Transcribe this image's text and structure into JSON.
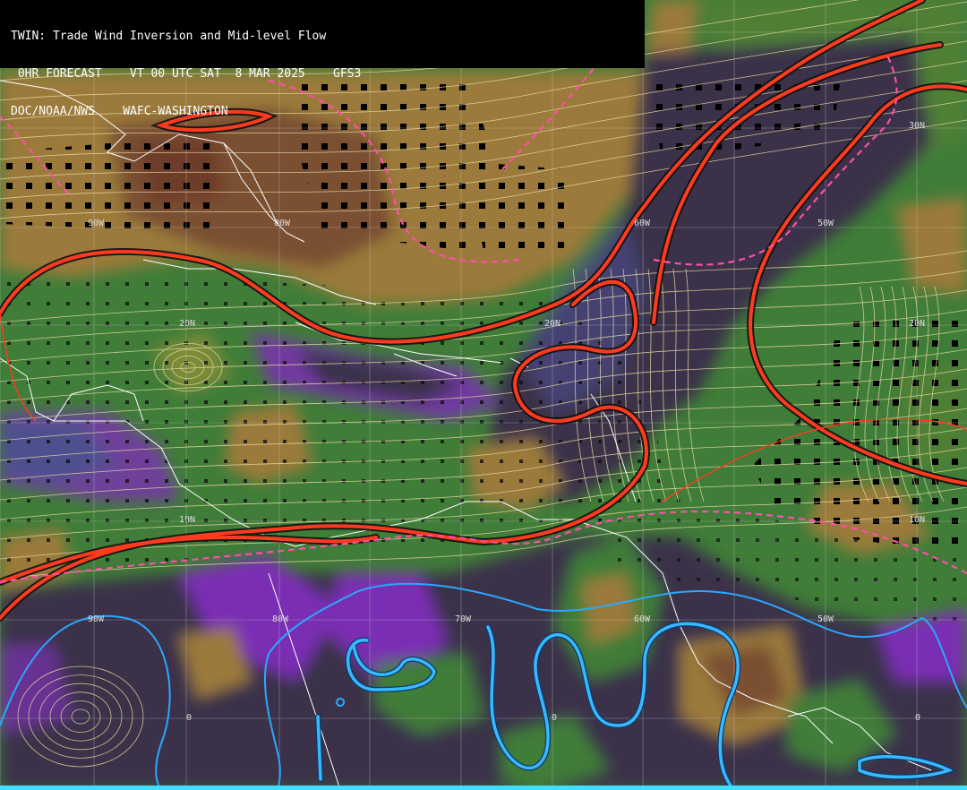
{
  "header": {
    "line1": "TWIN: Trade Wind Inversion and Mid-level Flow",
    "line2": " 0HR FORECAST    VT 00 UTC SAT  8 MAR 2025    GFS3",
    "line3": "DOC/NOAA/NWS    WAFC-WASHINGTON"
  },
  "map": {
    "lat_labels": [
      {
        "text": "30N"
      },
      {
        "text": "20N"
      },
      {
        "text": "20N"
      },
      {
        "text": "20N"
      },
      {
        "text": "10N"
      },
      {
        "text": "10N"
      }
    ],
    "lon_labels": [
      {
        "text": "90W"
      },
      {
        "text": "80W"
      },
      {
        "text": "60W"
      },
      {
        "text": "50W"
      },
      {
        "text": "90W"
      },
      {
        "text": "80W"
      },
      {
        "text": "70W"
      },
      {
        "text": "60W"
      },
      {
        "text": "50W"
      }
    ],
    "zero_labels": [
      "0",
      "0",
      "0"
    ],
    "colors": {
      "deep": "#3b3349",
      "purple": "#7a2fb3",
      "slate": "#4d4f8f",
      "green": "#3f7d38",
      "olive": "#7b8b37",
      "tan": "#9b7a3b",
      "brown": "#7a4f33",
      "contour_red": "#ff3b1f",
      "contour_pink": "#ff4fa8",
      "contour_blue": "#3ab8ff",
      "streamline": "#e8d9a0",
      "coast": "#ffffff",
      "grid": "#c8c8c8"
    }
  }
}
